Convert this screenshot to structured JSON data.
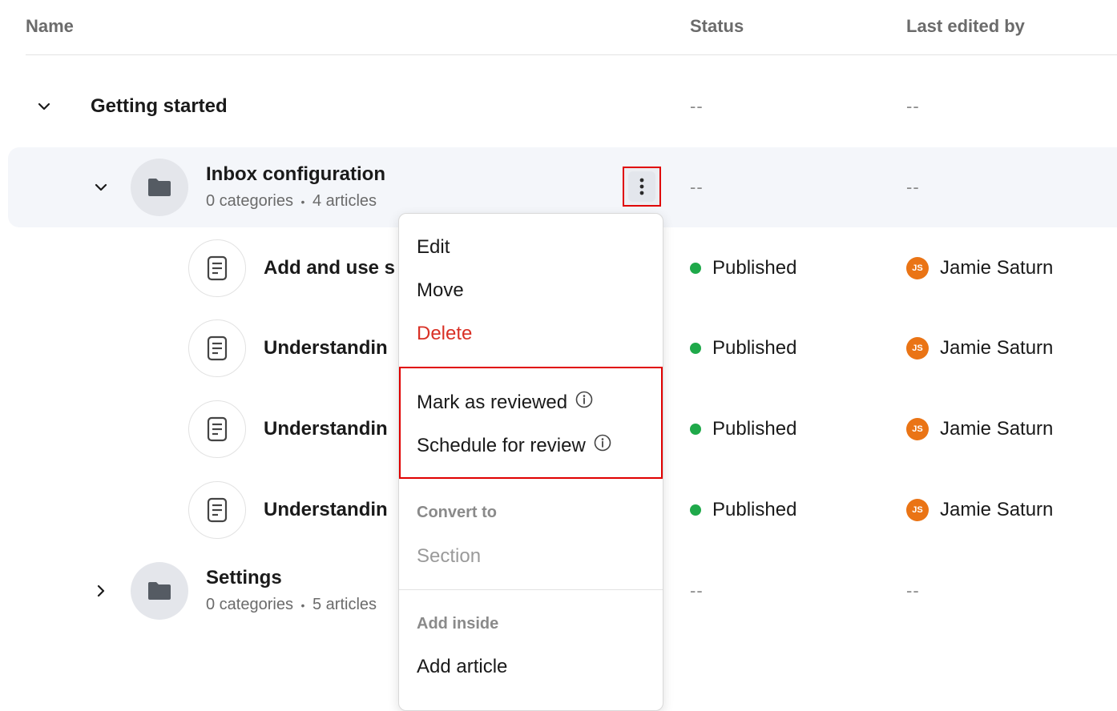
{
  "headers": {
    "name": "Name",
    "status": "Status",
    "last_edited_by": "Last edited by"
  },
  "group": {
    "title": "Getting started",
    "status": "--",
    "editor": "--"
  },
  "collection": {
    "title": "Inbox configuration",
    "categories": "0 categories",
    "separator": "•",
    "articles": "4 articles",
    "status": "--",
    "editor": "--"
  },
  "articles": [
    {
      "title": "Add and use s",
      "status": "Published",
      "editor": "Jamie Saturn",
      "initials": "JS"
    },
    {
      "title": "Understandin",
      "status": "Published",
      "editor": "Jamie Saturn",
      "initials": "JS"
    },
    {
      "title": "Understandin",
      "status": "Published",
      "editor": "Jamie Saturn",
      "initials": "JS"
    },
    {
      "title": "Understandin",
      "status": "Published",
      "editor": "Jamie Saturn",
      "initials": "JS"
    }
  ],
  "settings": {
    "title": "Settings",
    "categories": "0 categories",
    "separator": "•",
    "articles": "5 articles",
    "status": "--",
    "editor": "--"
  },
  "menu": {
    "edit": "Edit",
    "move": "Move",
    "delete": "Delete",
    "mark_reviewed": "Mark as reviewed",
    "schedule_review": "Schedule for review",
    "convert_to_label": "Convert to",
    "section": "Section",
    "add_inside_label": "Add inside",
    "add_article": "Add article"
  },
  "colors": {
    "published_dot": "#1fa94a",
    "avatar_bg": "#ea7415",
    "delete_text": "#d93025",
    "highlight_border": "#e00000",
    "row_highlight": "#f4f6fa"
  },
  "icons": {
    "chevron_down": "chevron-down-icon",
    "chevron_right": "chevron-right-icon",
    "folder": "folder-icon",
    "article": "article-icon",
    "kebab": "more-vertical-icon",
    "info": "info-icon"
  }
}
